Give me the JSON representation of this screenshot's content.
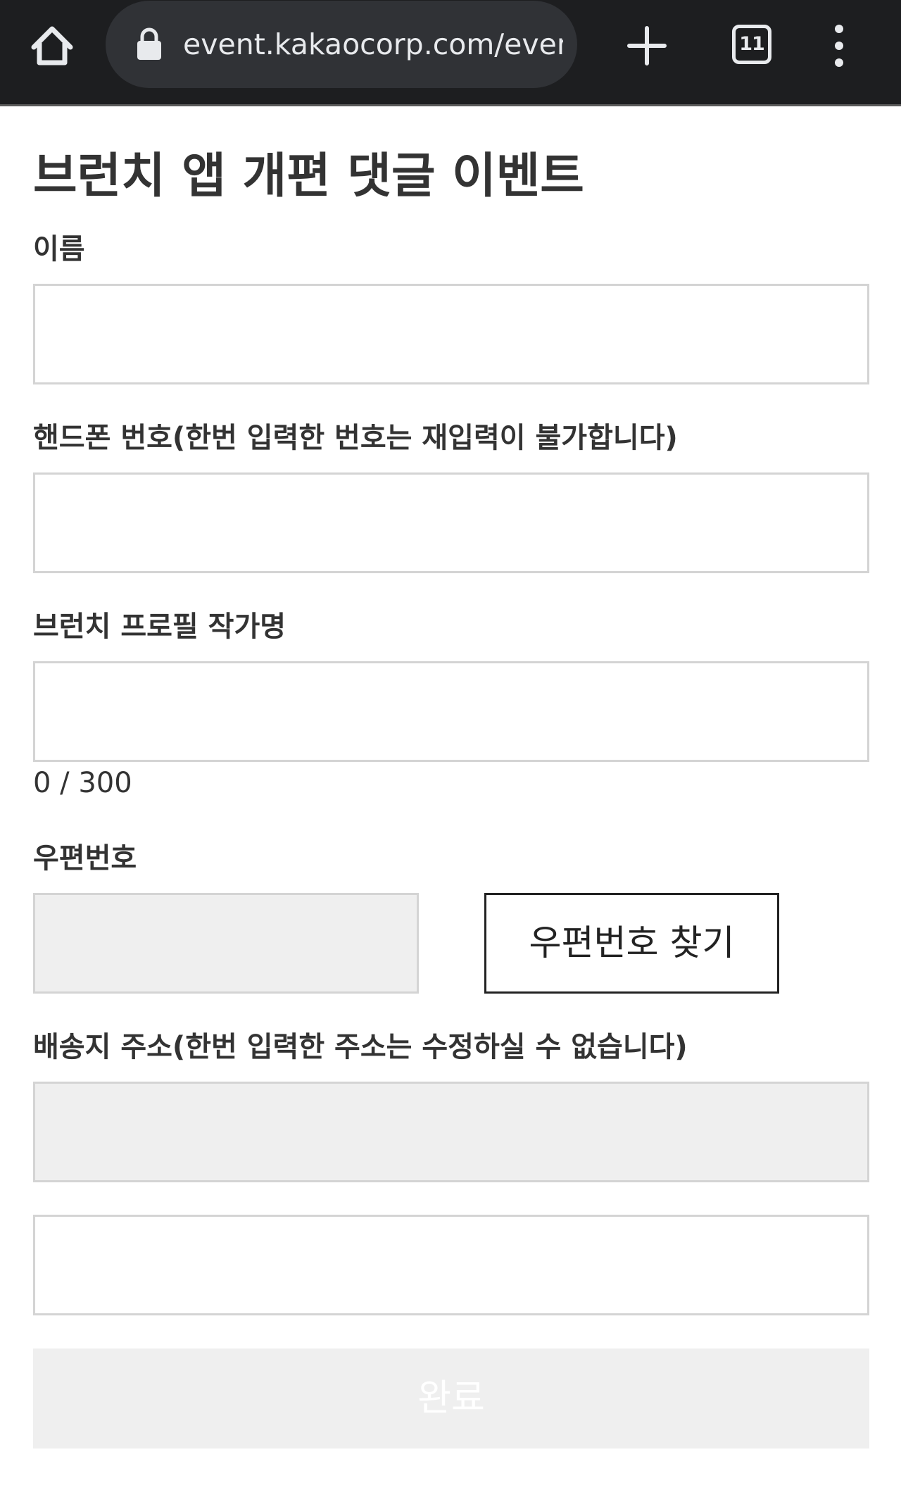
{
  "browser": {
    "url": "event.kakaocorp.com/even",
    "tab_count": "11",
    "icons": [
      "home-icon",
      "lock-icon",
      "new-tab-plus-icon",
      "tab-switcher-icon",
      "overflow-menu-icon"
    ],
    "colors": {
      "toolbar": "#1d1e20",
      "omnibox": "#303236",
      "icon": "#e8eaed"
    }
  },
  "page": {
    "title": "브런치 앱 개편 댓글 이벤트"
  },
  "form": {
    "name": {
      "label": "이름",
      "value": ""
    },
    "phone": {
      "label": "핸드폰 번호(한번 입력한 번호는 재입력이 불가합니다)",
      "value": ""
    },
    "author": {
      "label": "브런치 프로필 작가명",
      "value": "",
      "counter": "0 / 300"
    },
    "postal": {
      "label": "우편번호",
      "value": "",
      "search_button": "우편번호 찾기"
    },
    "address": {
      "label": "배송지 주소(한번 입력한 주소는 수정하실 수 없습니다)",
      "value": "",
      "detail_value": ""
    },
    "submit_label": "완료"
  },
  "colors": {
    "text": "#333333",
    "input_border": "#d4d4d4",
    "readonly_bg": "#efefef",
    "submit_disabled_bg": "#efefef"
  }
}
